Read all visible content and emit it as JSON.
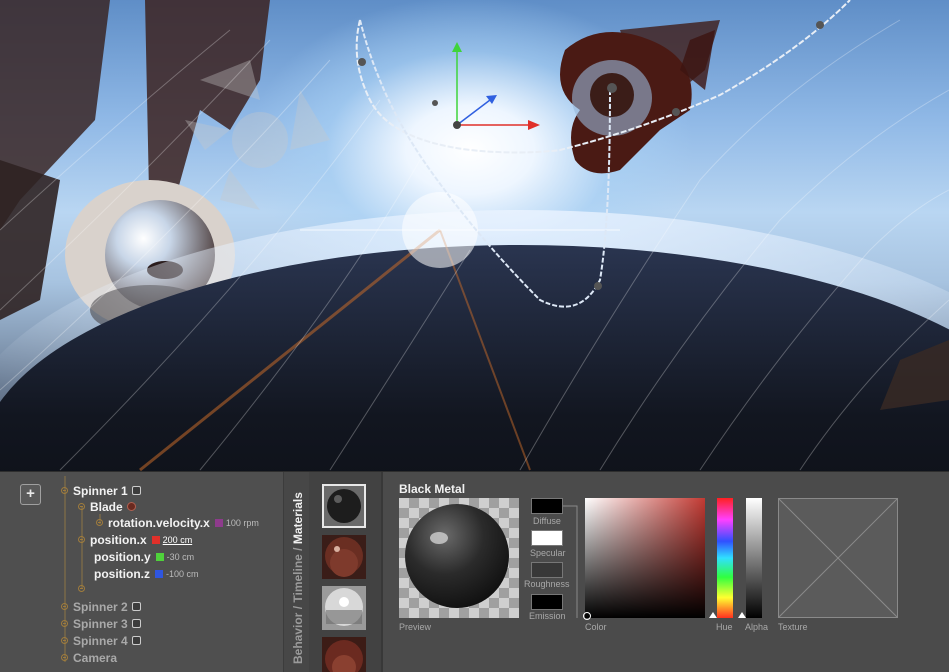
{
  "tree": {
    "add_label": "+",
    "items": [
      {
        "label": "Spinner 1",
        "level": 0,
        "dim": false
      },
      {
        "label": "Blade",
        "level": 1,
        "dim": false
      },
      {
        "label": "rotation.velocity.x",
        "level": 2,
        "dim": false,
        "value": "100 rpm",
        "swatch": "#8e3b8c"
      },
      {
        "label": "position.x",
        "level": 1,
        "dim": false,
        "value": "200 cm",
        "swatch": "#e0302a"
      },
      {
        "label": "position.y",
        "level": 1,
        "dim": false,
        "value": "-30 cm",
        "swatch": "#4fd23b"
      },
      {
        "label": "position.z",
        "level": 1,
        "dim": false,
        "value": "-100 cm",
        "swatch": "#2f56e0"
      },
      {
        "label": "Spinner 2",
        "level": 0,
        "dim": true
      },
      {
        "label": "Spinner 3",
        "level": 0,
        "dim": true
      },
      {
        "label": "Spinner 4",
        "level": 0,
        "dim": true
      },
      {
        "label": "Camera",
        "level": 0,
        "dim": true
      }
    ]
  },
  "tabs": {
    "behavior": "Behavior",
    "timeline": "Timeline",
    "materials": "Materials",
    "sep": " / "
  },
  "editor": {
    "material_name": "Black Metal",
    "preview_label": "Preview",
    "color_label": "Color",
    "hue_label": "Hue",
    "alpha_label": "Alpha",
    "texture_label": "Texture",
    "channels": [
      {
        "label": "Diffuse",
        "color": "#000000"
      },
      {
        "label": "Specular",
        "color": "#ffffff"
      },
      {
        "label": "Roughness",
        "color": "#383838"
      },
      {
        "label": "Emission",
        "color": "#000000"
      }
    ]
  },
  "colors": {
    "axis_x": "#e0302a",
    "axis_y": "#3fd43b",
    "axis_z": "#3060e0",
    "accent": "#a07c3c"
  }
}
